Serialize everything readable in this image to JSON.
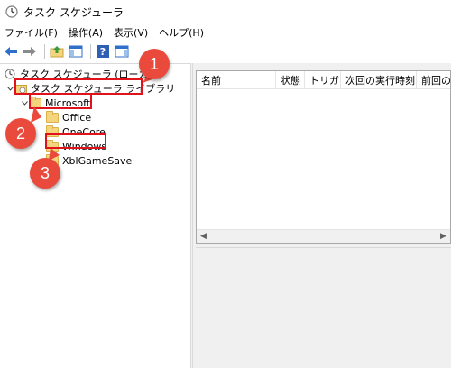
{
  "window": {
    "title": "タスク スケジューラ"
  },
  "menu": [
    {
      "label": "ファイル(F)"
    },
    {
      "label": "操作(A)"
    },
    {
      "label": "表示(V)"
    },
    {
      "label": "ヘルプ(H)"
    }
  ],
  "toolbar": {
    "buttons": [
      "back-arrow-icon",
      "forward-arrow-icon",
      "folder-up-icon",
      "console-tree-icon",
      "help-icon",
      "action-pane-icon"
    ]
  },
  "tree": {
    "root": {
      "label": "タスク スケジューラ (ローカル)"
    },
    "library": {
      "label": "タスク スケジューラ ライブラリ"
    },
    "microsoft": {
      "label": "Microsoft"
    },
    "children": [
      {
        "label": "Office"
      },
      {
        "label": "OneCore"
      },
      {
        "label": "Windows"
      },
      {
        "label": "XblGameSave"
      }
    ]
  },
  "list": {
    "columns": [
      {
        "label": "名前"
      },
      {
        "label": "状態"
      },
      {
        "label": "トリガー"
      },
      {
        "label": "次回の実行時刻"
      },
      {
        "label": "前回の実"
      }
    ]
  },
  "callouts": [
    {
      "label": "1"
    },
    {
      "label": "2"
    },
    {
      "label": "3"
    }
  ],
  "colors": {
    "highlight": "#e0121b",
    "callout": "#ea4a3c",
    "folder": "#f4d47c"
  }
}
